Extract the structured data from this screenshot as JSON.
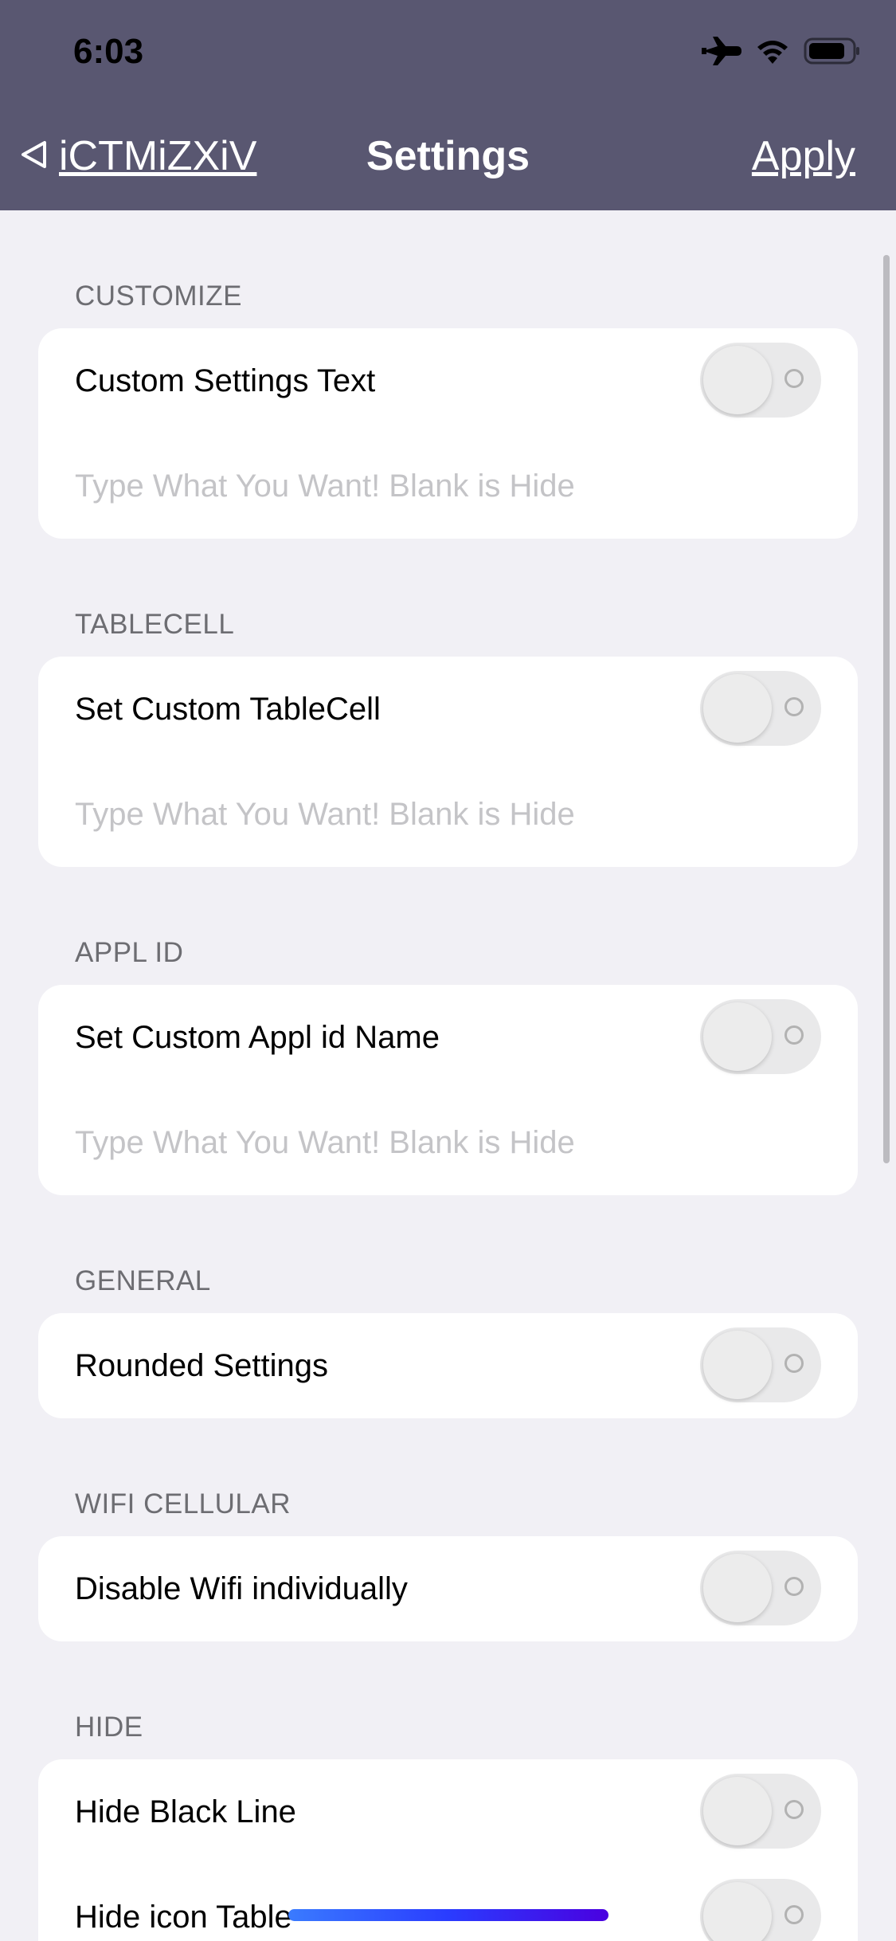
{
  "status_bar": {
    "time": "6:03",
    "icons": [
      "airplane-icon",
      "wifi-icon",
      "battery-icon"
    ]
  },
  "nav": {
    "back_label": "iCTMiZXiV",
    "title": "Settings",
    "apply_label": "Apply"
  },
  "sections": {
    "customize": {
      "header": "CUSTOMIZE",
      "label": "Custom Settings Text",
      "placeholder": "Type What You Want! Blank is Hide",
      "toggle_on": false
    },
    "tablecell": {
      "header": "TABLECELL",
      "label": "Set Custom TableCell",
      "placeholder": "Type What You Want! Blank is Hide",
      "toggle_on": false
    },
    "appl_id": {
      "header": "APPL ID",
      "label": "Set Custom Appl id Name",
      "placeholder": "Type What You Want! Blank is Hide",
      "toggle_on": false
    },
    "general": {
      "header": "GENERAL",
      "label": "Rounded Settings",
      "toggle_on": false
    },
    "wifi_cellular": {
      "header": "WIFI CELLULAR",
      "label": "Disable Wifi individually",
      "toggle_on": false
    },
    "hide": {
      "header": "HIDE",
      "items": [
        {
          "label": "Hide Black Line",
          "toggle_on": false
        },
        {
          "label": "Hide icon Table",
          "toggle_on": false
        }
      ]
    }
  },
  "colors": {
    "nav_background": "#595771",
    "page_background": "#f1f0f5",
    "card_background": "#ffffff",
    "placeholder": "#c4c4c7",
    "section_header": "#6d6d72"
  }
}
